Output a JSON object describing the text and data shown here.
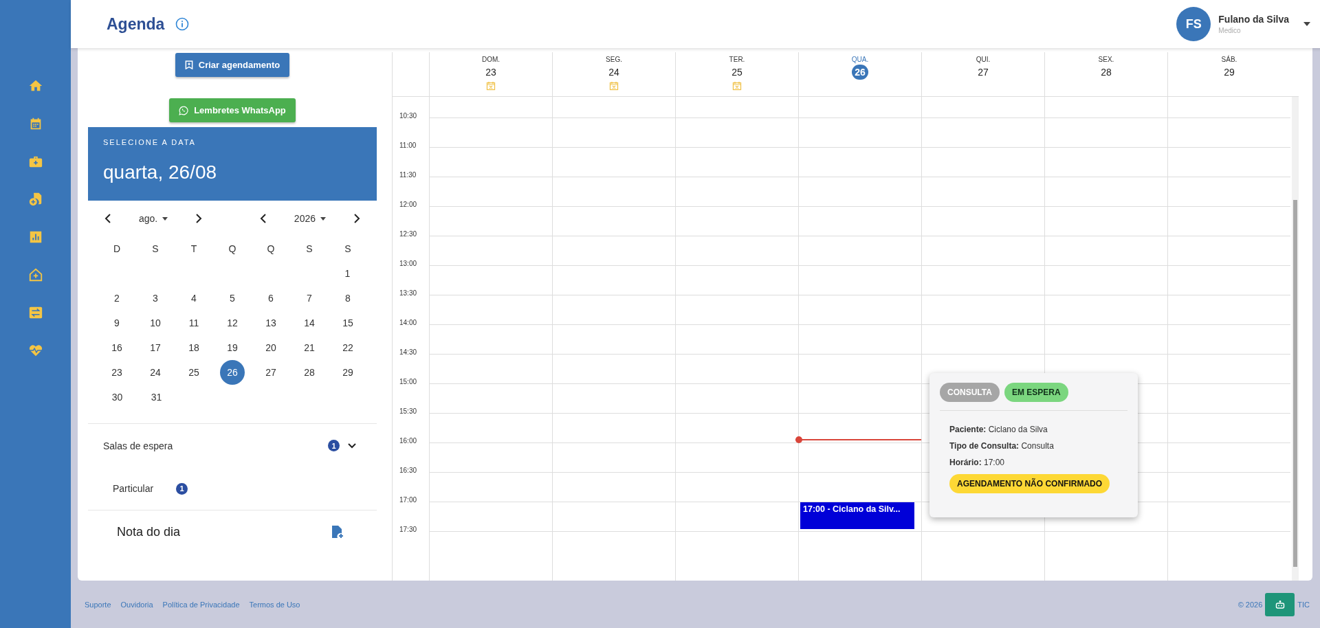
{
  "header": {
    "title": "Agenda",
    "user": {
      "initials": "FS",
      "name": "Fulano da Silva",
      "role": "Medico"
    }
  },
  "nav": [
    {
      "kind": "home"
    },
    {
      "kind": "calendar"
    },
    {
      "kind": "briefcase"
    },
    {
      "kind": "file-plus"
    },
    {
      "kind": "chart"
    },
    {
      "kind": "house-plus"
    },
    {
      "kind": "swap"
    },
    {
      "kind": "heart"
    }
  ],
  "actions": [
    {
      "kind": "schedule",
      "label": "Criar agendamento"
    },
    {
      "kind": "whatsapp",
      "label": "Lembretes WhatsApp"
    }
  ],
  "date_picker": {
    "caption": "SELECIONE A DATA",
    "selected_date": "quarta, 26/08",
    "month": "ago.",
    "year": "2026",
    "weekdays": [
      "D",
      "S",
      "T",
      "Q",
      "Q",
      "S",
      "S"
    ],
    "weeks": [
      [
        {
          "label": "1",
          "selected": false
        }
      ],
      [
        {
          "label": "2",
          "selected": false
        },
        {
          "label": "3",
          "selected": false
        },
        {
          "label": "4",
          "selected": false
        },
        {
          "label": "5",
          "selected": false
        },
        {
          "label": "6",
          "selected": false
        },
        {
          "label": "7",
          "selected": false
        },
        {
          "label": "8",
          "selected": false
        }
      ],
      [
        {
          "label": "9",
          "selected": false
        },
        {
          "label": "10",
          "selected": false
        },
        {
          "label": "11",
          "selected": false
        },
        {
          "label": "12",
          "selected": false
        },
        {
          "label": "13",
          "selected": false
        },
        {
          "label": "14",
          "selected": false
        },
        {
          "label": "15",
          "selected": false
        }
      ],
      [
        {
          "label": "16",
          "selected": false
        },
        {
          "label": "17",
          "selected": false
        },
        {
          "label": "18",
          "selected": false
        },
        {
          "label": "19",
          "selected": false
        },
        {
          "label": "20",
          "selected": false
        },
        {
          "label": "21",
          "selected": false
        },
        {
          "label": "22",
          "selected": false
        }
      ],
      [
        {
          "label": "23",
          "selected": false
        },
        {
          "label": "24",
          "selected": false
        },
        {
          "label": "25",
          "selected": false
        },
        {
          "label": "26",
          "selected": true
        },
        {
          "label": "27",
          "selected": false
        },
        {
          "label": "28",
          "selected": false
        },
        {
          "label": "29",
          "selected": false
        }
      ],
      [
        {
          "label": "30",
          "selected": false
        },
        {
          "label": "31",
          "selected": false
        }
      ]
    ]
  },
  "waiting_rooms": {
    "label": "Salas de espera",
    "count": "1",
    "expanded": true,
    "rooms": [
      {
        "name": "Particular",
        "count": "1"
      }
    ]
  },
  "note": {
    "label": "Nota do dia"
  },
  "calendar": {
    "days": [
      {
        "weekday": "DOM.",
        "date": "23",
        "selected": false,
        "blocked": true,
        "now": false
      },
      {
        "weekday": "SEG.",
        "date": "24",
        "selected": false,
        "blocked": true,
        "now": false
      },
      {
        "weekday": "TER.",
        "date": "25",
        "selected": false,
        "blocked": true,
        "now": false
      },
      {
        "weekday": "QUA.",
        "date": "26",
        "selected": true,
        "blocked": false,
        "now": true,
        "events": [
          {
            "label": "17:00 - Ciclano da Silv..."
          }
        ]
      },
      {
        "weekday": "QUI.",
        "date": "27",
        "selected": false,
        "blocked": false,
        "now": false
      },
      {
        "weekday": "SEX.",
        "date": "28",
        "selected": false,
        "blocked": false,
        "now": false
      },
      {
        "weekday": "SÁB.",
        "date": "29",
        "selected": false,
        "blocked": false,
        "now": false
      }
    ],
    "times": [
      "10:30",
      "11:00",
      "11:30",
      "12:00",
      "12:30",
      "13:00",
      "13:30",
      "14:00",
      "14:30",
      "15:00",
      "15:30",
      "16:00",
      "16:30",
      "17:00",
      "17:30"
    ]
  },
  "popover": {
    "tags": [
      {
        "label": "CONSULTA",
        "color": "#a6a6a6"
      },
      {
        "label": "EM ESPERA",
        "color": "#7bd67f"
      }
    ],
    "fields": [
      "**Paciente:** Ciclano da Silva",
      "**Tipo de Consulta:** Consulta",
      "**Horário:** 17:00"
    ],
    "status": "AGENDAMENTO NÃO CONFIRMADO"
  },
  "footer": {
    "links": [
      "Suporte",
      "Ouvidoria",
      "Política de Privacidade",
      "Termos de Uso"
    ],
    "copyright": "© 2026",
    "copyright_tail": "TIC"
  }
}
